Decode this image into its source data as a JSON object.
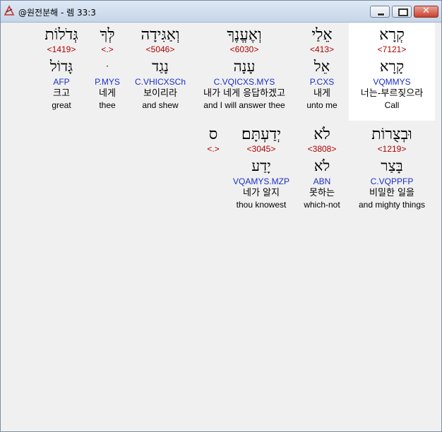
{
  "window": {
    "title": "@원전분해 - 렘 33:3",
    "min_label": "",
    "max_label": "",
    "close_label": "✕"
  },
  "line1": [
    {
      "heb": "קְרָא",
      "strong": "<7121>",
      "lemma": "קָרָא",
      "morph": "VQMMYS",
      "kor": "너는-부르짖으라",
      "eng": "Call"
    },
    {
      "heb": "אֵלַי",
      "strong": "<413>",
      "lemma": "אֵל",
      "morph": "P.CXS",
      "kor": "내게",
      "eng": "unto me"
    },
    {
      "heb": "וְאֶעֱנֶךָ",
      "strong": "<6030>",
      "lemma": "עָנָה",
      "morph": "C.VQICXS.MYS",
      "kor": "내가 네게 응답하겠고",
      "eng": "and I will answer thee"
    },
    {
      "heb": "וְאַגִּידָה",
      "strong": "<5046>",
      "lemma": "נָגַד",
      "morph": "C.VHICXSCh",
      "kor": "보이리라",
      "eng": "and shew"
    },
    {
      "heb": "לְּךָ",
      "strong": "<.>",
      "lemma": "ּ",
      "morph": "P.MYS",
      "kor": "네게",
      "eng": "thee"
    },
    {
      "heb": "גְּדֹלוֹת",
      "strong": "<1419>",
      "lemma": "גָּדוֹל",
      "morph": "AFP",
      "kor": "크고",
      "eng": "great"
    }
  ],
  "line2": [
    {
      "heb": "וּבְצֻרוֹת",
      "strong": "<1219>",
      "lemma": "בָּצַר",
      "morph": "C.VQPPFP",
      "kor": "비밀한 일을",
      "eng": "and mighty things"
    },
    {
      "heb": "לֹא",
      "strong": "<3808>",
      "lemma": "לֹא",
      "morph": "ABN",
      "kor": "못하는",
      "eng": "which-not"
    },
    {
      "heb": "יְדַעְתָּם׃",
      "strong": "<3045>",
      "lemma": "יָדַע",
      "morph": "VQAMYS.MZP",
      "kor": "네가 알지",
      "eng": "thou knowest"
    },
    {
      "heb": "ס",
      "strong": "<.>",
      "lemma": "",
      "morph": "",
      "kor": "",
      "eng": ""
    }
  ]
}
